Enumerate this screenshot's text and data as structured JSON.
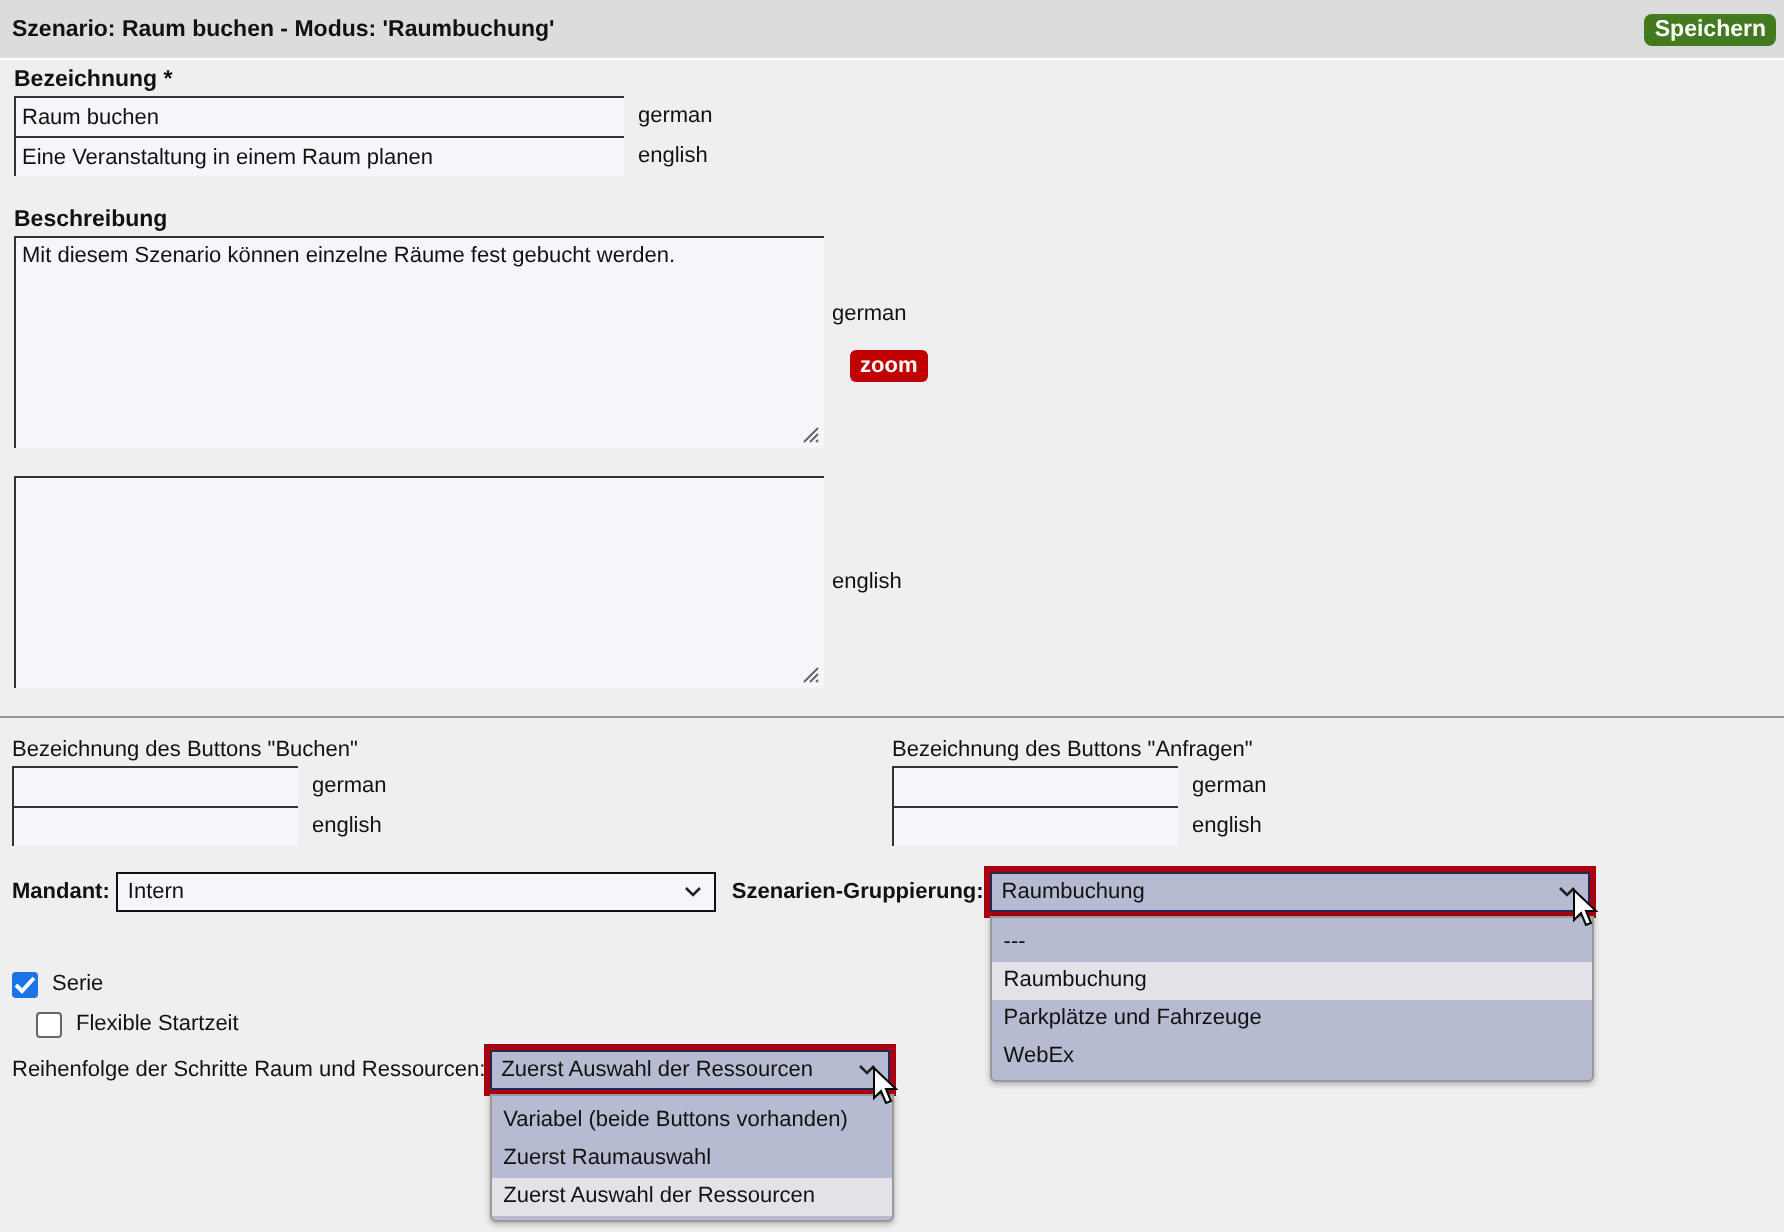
{
  "header": {
    "title": "Szenario: Raum buchen - Modus: 'Raumbuchung'",
    "save_button": "Speichern"
  },
  "name_section": {
    "label": "Bezeichnung *",
    "fields": [
      {
        "value": "Raum buchen",
        "language": "german"
      },
      {
        "value": "Eine Veranstaltung in einem Raum planen",
        "language": "english"
      }
    ]
  },
  "description_section": {
    "label": "Beschreibung",
    "zoom_button": "zoom",
    "fields": [
      {
        "value": "Mit diesem Szenario können einzelne Räume fest gebucht werden.",
        "language": "german"
      },
      {
        "language": "english"
      }
    ]
  },
  "button_labels": [
    {
      "label": "Bezeichnung des Buttons \"Buchen\"",
      "languages": [
        "german",
        "english"
      ]
    },
    {
      "label": "Bezeichnung des Buttons \"Anfragen\"",
      "languages": [
        "german",
        "english"
      ]
    }
  ],
  "mandant": {
    "label": "Mandant:",
    "value": "Intern"
  },
  "grouping": {
    "label": "Szenarien-Gruppierung:",
    "value": "Raumbuchung",
    "expanded": true,
    "options": [
      {
        "label": "---",
        "selected": false
      },
      {
        "label": "Raumbuchung",
        "selected": true
      },
      {
        "label": "Parkplätze und Fahrzeuge",
        "selected": false
      },
      {
        "label": "WebEx",
        "selected": false
      }
    ]
  },
  "checkboxes": [
    {
      "label": "Serie",
      "checked": true,
      "children": [
        {
          "label": "Flexible Startzeit",
          "checked": false
        }
      ]
    }
  ],
  "step_order": {
    "label": "Reihenfolge der Schritte Raum und Ressourcen:",
    "value": "Zuerst Auswahl der Ressourcen",
    "expanded": true,
    "options": [
      {
        "label": "Variabel (beide Buttons vorhanden)",
        "selected": false
      },
      {
        "label": "Zuerst Raumauswahl",
        "selected": false
      },
      {
        "label": "Zuerst Auswahl der Ressourcen",
        "selected": true
      }
    ]
  }
}
